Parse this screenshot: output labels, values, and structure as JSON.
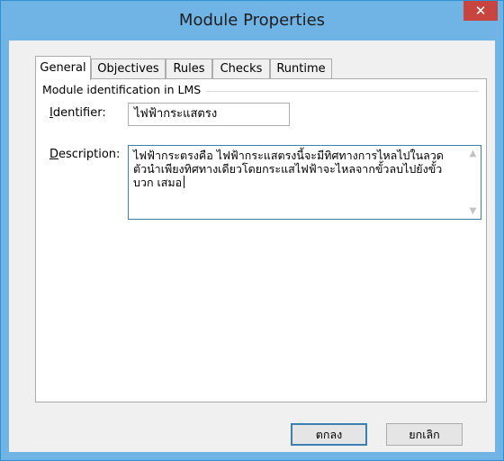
{
  "window": {
    "title": "Module Properties",
    "close_glyph": "✕"
  },
  "tabs": [
    {
      "label": "General",
      "active": true
    },
    {
      "label": "Objectives",
      "active": false
    },
    {
      "label": "Rules",
      "active": false
    },
    {
      "label": "Checks",
      "active": false
    },
    {
      "label": "Runtime",
      "active": false
    }
  ],
  "group": {
    "label": "Module identification in LMS"
  },
  "identifier": {
    "label_mnemonic": "I",
    "label_rest": "dentifier:",
    "value": "ไฟฟ้ากระแสตรง"
  },
  "description": {
    "label_mnemonic": "D",
    "label_rest": "escription:",
    "value": "ไฟฟ้ากระตรงคือ ไฟฟ้ากระแสตรงนี้จะมีทิศทางการไหลไปในลวดตัวนำเพียงทิศทางเดียวโดยกระแสไฟฟ้าจะไหลจากขั้วลบไปยังขั้วบวก เสมอ",
    "scroll_up_icon": "chevron-up",
    "scroll_down_icon": "chevron-down"
  },
  "buttons": {
    "ok_label": "ตกลง",
    "cancel_label": "ยกเลิก"
  },
  "colors": {
    "title_bar": "#70b4e6",
    "close_button": "#c7453e",
    "focus_border": "#3c7fb1"
  }
}
